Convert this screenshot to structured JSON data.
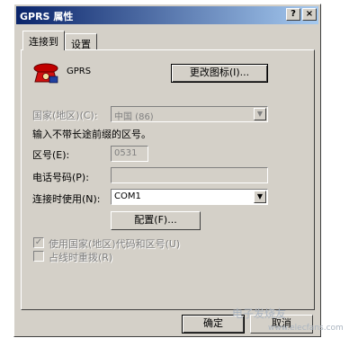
{
  "window": {
    "title": "GPRS 属性",
    "help_label": "?",
    "close_label": "×"
  },
  "tabs": [
    {
      "label": "连接到"
    },
    {
      "label": "设置"
    }
  ],
  "connection": {
    "name": "GPRS",
    "change_icon_label": "更改图标(I)..."
  },
  "country": {
    "label": "国家(地区)(C):",
    "value": "中国 (86)"
  },
  "note": "输入不带长途前缀的区号。",
  "area_code": {
    "label": "区号(E):",
    "value": "0531"
  },
  "phone": {
    "label": "电话号码(P):",
    "value": ""
  },
  "connect_using": {
    "label": "连接时使用(N):",
    "value": "COM1"
  },
  "configure_label": "配置(F)...",
  "checkboxes": [
    {
      "label": "使用国家(地区)代码和区号(U)",
      "checked": true
    },
    {
      "label": "占线时重拨(R)",
      "checked": false
    }
  ],
  "footer": {
    "ok_label": "确定",
    "cancel_label": "取消"
  },
  "watermark": {
    "text": "电子发烧友",
    "sub": "www.elecfans.com"
  },
  "icons": {
    "phone": "phone-icon",
    "dropdown": "chevron-down-icon"
  }
}
